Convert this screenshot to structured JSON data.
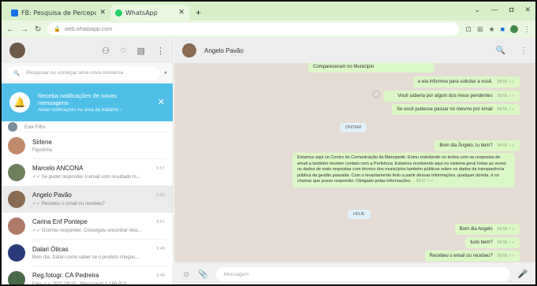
{
  "browser": {
    "tabs": [
      {
        "label": "FB: Pesquisa de Percepção - eko",
        "fav_color": "#1a73e8",
        "active": false
      },
      {
        "label": "WhatsApp",
        "fav_color": "#25d366",
        "active": true
      }
    ],
    "url": "web.whatsapp.com",
    "new_tab": "+",
    "window_controls": [
      "⌄",
      "—",
      "◘",
      "✕"
    ]
  },
  "sidebar": {
    "search_placeholder": "Pesquisar ou começar uma nova conversa",
    "notification": {
      "title": "Receba notificações de novas mensagens",
      "subtitle": "Ativar notificações na área de trabalho ›"
    },
    "chats": [
      {
        "name": "",
        "last": "Este Filho",
        "time": "",
        "color": "#7a8b9c",
        "selected": false,
        "partial": true
      },
      {
        "name": "Sirlene",
        "last": "Figurinha",
        "time": "",
        "color": "#c28a6b",
        "selected": false
      },
      {
        "name": "Marcelo ANCONA",
        "last": "✓✓ Se puder responder o email com resultado m...",
        "time": "9:57",
        "color": "#6e7f5e",
        "selected": false
      },
      {
        "name": "Angelo Pavão",
        "last": "✓✓ Recebeu o email ou recebeu?",
        "time": "9:56",
        "color": "#8a6a50",
        "selected": true
      },
      {
        "name": "Carina Enf Pontepe",
        "last": "✓✓ Ocorreu responder. Conseguiu encontrar resu...",
        "time": "9:51",
        "color": "#b07a6a",
        "selected": false
      },
      {
        "name": "Dalari Óticas",
        "last": "Bom dia, Dalari como saber se o produto chegou...",
        "time": "9:48",
        "color": "#2b3a7a",
        "selected": false
      },
      {
        "name": "Reg.fotogr. CA Pedreira",
        "last": "Foto ✓✓ 2021 09:15 · Mensagem 1.168.013",
        "time": "9:44",
        "color": "#4a6a4a",
        "selected": false
      }
    ]
  },
  "conversation": {
    "contact": "Angelo Pavão",
    "messages": [
      {
        "text": "Compareceram no Município",
        "time": ""
      },
      {
        "text": "e ela informou para solicitar a você.",
        "time": "09:55 ✓✓"
      },
      {
        "text": "Você saberia por algum dos meus pendentes",
        "time": "09:55 ✓✓"
      },
      {
        "text": "Se você pudesse passar no mesmo por email",
        "time": "09:55 ✓✓"
      },
      {
        "text": "Bom dia Ângelo, tu bem?",
        "time": "09:56 ✓✓"
      },
      {
        "text": "Estamos aqui no Centro de Comunicação da Manopede. Estou mandando os textos com as respostas de email a também receber contato com a Prefeitura. Estamos recebendo aqui no sistema geral todas as vezes os dados de mais respostas com técnico dos municípios também públicos sobre os dados da transparência pública da gestão passada. Com o levantamento feito a partir dessas informações, qualquer dúvida, é só chamar que posso responder. Obrigado pelas informações.",
        "time": "09:57 ✓✓"
      },
      {
        "text": "Bom dia Angelo",
        "time": "09:58 ✓✓"
      },
      {
        "text": "tudo bem?",
        "time": "09:58 ✓✓"
      },
      {
        "text": "Recebeu o email ou recebeu?",
        "time": "09:58 ✓✓"
      }
    ],
    "day_labels": [
      "ONTEM",
      "HOJE"
    ],
    "compose_placeholder": "Mensagem"
  },
  "colors": {
    "accent": "#25d366",
    "bubble_out": "#dcf8c6",
    "notif": "#4fbfe8"
  },
  "icons": [
    "status-icon",
    "new-chat-icon",
    "menu-icon",
    "search-icon",
    "emoji-icon",
    "attach-icon",
    "mic-icon",
    "bell-off-icon"
  ]
}
